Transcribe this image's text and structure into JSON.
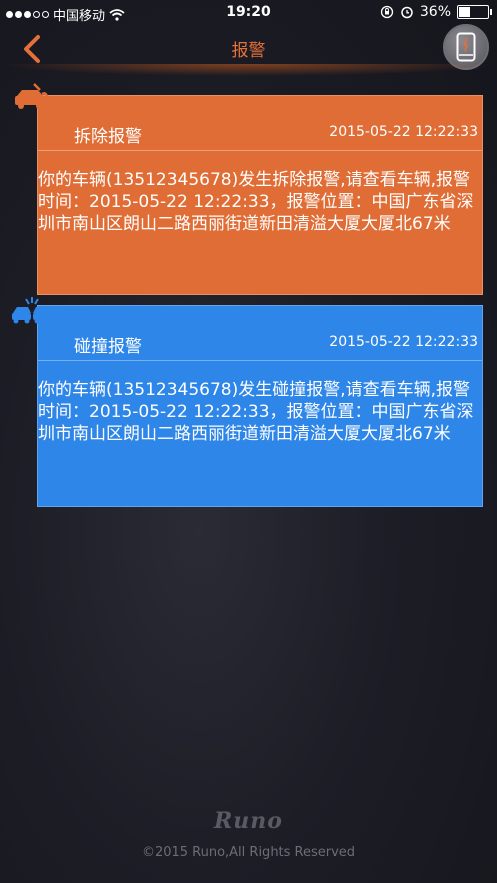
{
  "status_bar": {
    "carrier": "中国移动",
    "time": "19:20",
    "battery": "36%"
  },
  "nav": {
    "title": "报警"
  },
  "alerts": [
    {
      "title": "拆除报警",
      "time": "2015-05-22 12:22:33",
      "message": "你的车辆(13512345678)发生拆除报警,请查看车辆,报警时间：2015-05-22 12:22:33，报警位置：中国广东省深圳市南山区朗山二路西丽街道新田清溢大厦大厦北67米",
      "color": "#e06d36",
      "icon": "car-remove-icon"
    },
    {
      "title": "碰撞报警",
      "time": "2015-05-22 12:22:33",
      "message": "你的车辆(13512345678)发生碰撞报警,请查看车辆,报警时间：2015-05-22 12:22:33，报警位置：中国广东省深圳市南山区朗山二路西丽街道新田清溢大厦大厦北67米",
      "color": "#2e86e8",
      "icon": "car-collision-icon"
    }
  ],
  "footer": {
    "logo": "Runo",
    "copyright": "©2015 Runo,All Rights Reserved"
  }
}
